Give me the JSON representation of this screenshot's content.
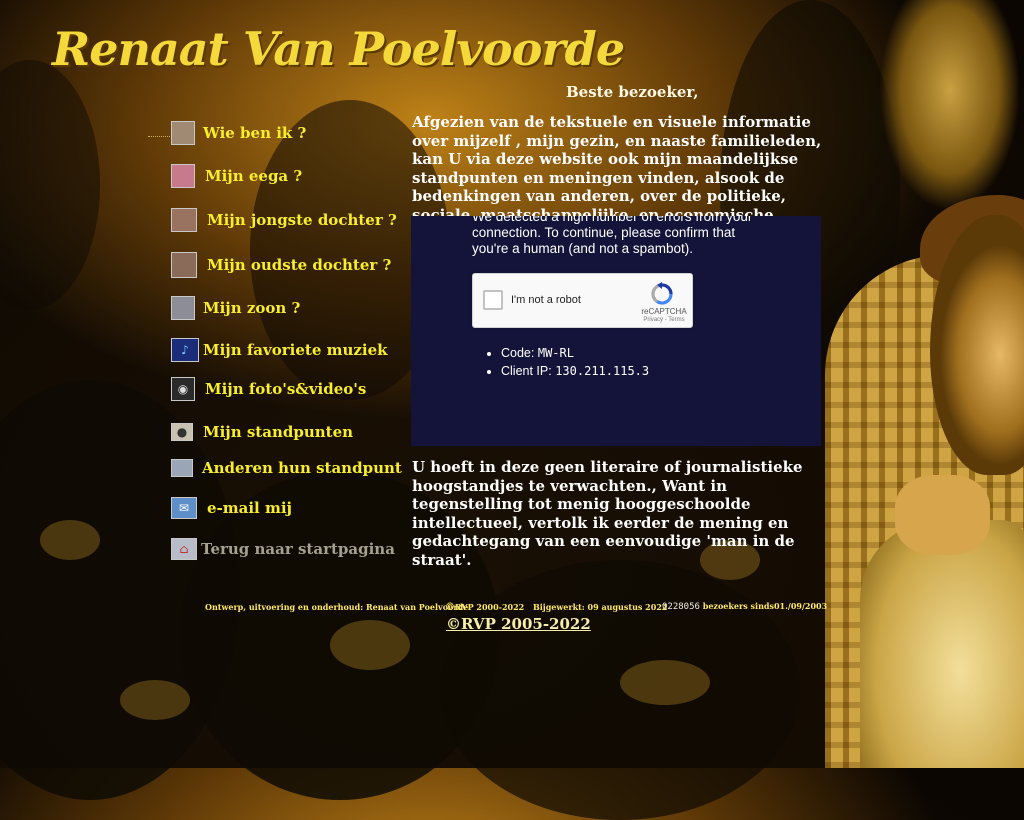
{
  "header": {
    "title": "Renaat Van Poelvoorde"
  },
  "nav": {
    "items": [
      {
        "label": "Wie ben ik ?",
        "icon": "portrait-thumbnail-icon"
      },
      {
        "label": "Mijn eega ?",
        "icon": "portrait-thumbnail-icon"
      },
      {
        "label": "Mijn jongste dochter ?",
        "icon": "portrait-thumbnail-icon"
      },
      {
        "label": "Mijn oudste dochter ?",
        "icon": "portrait-thumbnail-icon"
      },
      {
        "label": "Mijn zoon ?",
        "icon": "portrait-thumbnail-icon"
      },
      {
        "label": "Mijn favoriete muziek",
        "icon": "music-icon"
      },
      {
        "label": "Mijn foto's&video's",
        "icon": "camera-icon"
      },
      {
        "label": "Mijn standpunten",
        "icon": "stamp-icon"
      },
      {
        "label": "Anderen hun standpunt",
        "icon": "newspaper-icon"
      },
      {
        "label": "e-mail mij",
        "icon": "envelope-icon"
      },
      {
        "label": "Terug naar startpagina",
        "icon": "home-icon"
      }
    ]
  },
  "main": {
    "greeting": "Beste bezoeker,",
    "intro": "Afgezien van de tekstuele en visuele informatie over mijzelf , mijn gezin, en naaste familieleden, kan U via deze website ook mijn maandelijkse standpunten en  meningen vinden, alsook de bedenkingen  van anderen, over de politieke, sociale, maatschappelijke, en economische actualiteit.",
    "outro": "U hoeft in deze geen literaire of journalistieke hoogstandjes te verwachten., Want in tegenstelling tot  menig hooggeschoolde intellectueel, vertolk ik  eerder de mening en gedachtegang van een eenvoudige 'man in de straat'."
  },
  "captcha": {
    "message": "We detected a high number of errors from your connection. To continue, please confirm that you're a human (and not a spambot).",
    "checkbox_label": "I'm not a robot",
    "brand": "reCAPTCHA",
    "terms": "Privacy - Terms",
    "code_label": "Code:",
    "code_value": "MW-RL",
    "ip_label": "Client IP:",
    "ip_value": "130.211.115.3"
  },
  "footer": {
    "credit": "Ontwerp,  uitvoering en onderhoud:  Renaat van Poelvoorde",
    "copyright_small": "RVP 2000-2022",
    "updated": "Bijgewerkt: 09 augustus 2022",
    "counter": "0228056",
    "visitors": "bezoekers sinds01./09/2003",
    "copyright": "©RVP  2005-2022"
  },
  "colors": {
    "title": "#f5d93a",
    "nav_link": "#f8ee2a",
    "captcha_bg": "#14143a"
  }
}
